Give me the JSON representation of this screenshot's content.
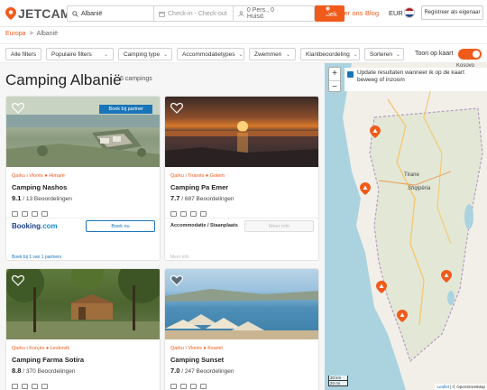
{
  "header": {
    "logo_text": "JETCAMP",
    "search": {
      "location": "Albanië",
      "dates_placeholder": "Check-in - Check-out",
      "guests": "0 Pers., 0 Huisd.",
      "search_button": "Zoek"
    },
    "favorites_count": "0",
    "nav": {
      "about": "Over ons",
      "blog": "Blog"
    },
    "currency": "EUR",
    "owner_button": "Registreer als eigenaar"
  },
  "breadcrumb": {
    "home": "Europa",
    "current": "Albanië",
    "separator": ">"
  },
  "filters": {
    "items": [
      {
        "label": "Alle filters"
      },
      {
        "label": "Populaire filters"
      },
      {
        "label": "Camping type"
      },
      {
        "label": "Accommodatietypes"
      },
      {
        "label": "Zwemmen"
      },
      {
        "label": "Klantbeoordeling"
      },
      {
        "label": "Sorteren"
      }
    ],
    "map_toggle_label": "Toon op kaart",
    "map_toggle_on": true
  },
  "list": {
    "title": "Camping Albanië",
    "count": "6 campings",
    "cards": [
      {
        "location": "Qarku i Vlorës ● Himarë",
        "name": "Camping Nashos",
        "score": "9.1",
        "reviews": "/ 13 Beoordelingen",
        "partner_tag": "Boek bij partner",
        "booking_logo_1": "Booking",
        "booking_logo_2": ".com",
        "book_button": "Boek nu",
        "partners_link": "Boek bij 1 van 1 partners"
      },
      {
        "location": "Qarku i Tiranës ● Golem",
        "name": "Camping Pa Emer",
        "score": "7.7",
        "reviews": "/ 687 Beoordelingen",
        "accommodation": "Accommodatie / Staanplaats",
        "more_button": "Meer info",
        "more_info": "Meer info"
      },
      {
        "location": "Qarku i Korçës ● Leskovik",
        "name": "Camping Farma Sotira",
        "score": "8.8",
        "reviews": "/ 370 Beoordelingen"
      },
      {
        "location": "Qarku i Vlorës ● Ksamil",
        "name": "Camping Sunset",
        "score": "7.0",
        "reviews": "/ 247 Beoordelingen"
      }
    ]
  },
  "map": {
    "zoom_in": "+",
    "zoom_out": "−",
    "update_text": "Update resultaten wanneer ik op de kaart beweeg of inzoom",
    "labels": {
      "kosovo": "Kosovo",
      "tirane": "Tirane",
      "shqiperia": "Shqipëria"
    },
    "scale_km": "30 km",
    "scale_mi": "20 mi",
    "attribution_1": "Leaflet",
    "attribution_2": "| © OpenStreetMap"
  },
  "colors": {
    "accent": "#f05a1a",
    "partner_blue": "#1a75b8",
    "booking_navy": "#1a3e8c"
  }
}
